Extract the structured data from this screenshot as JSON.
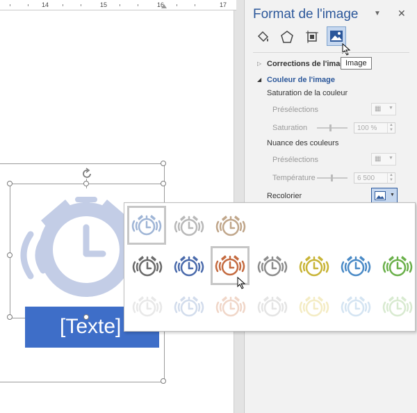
{
  "ruler": {
    "labels": [
      "14",
      "15",
      "16",
      "17"
    ]
  },
  "document": {
    "textbox_label": "[Texte]"
  },
  "panel": {
    "title": "Format de l'image",
    "close_glyph": "✕",
    "menu_glyph": "▼",
    "icons": [
      "fill-line-icon",
      "effects-icon",
      "layout-size-icon",
      "picture-icon"
    ],
    "tooltip": "Image",
    "sections": {
      "corrections": "Corrections de l'image",
      "couleur": "Couleur de l'image"
    },
    "saturation": {
      "header": "Saturation de la couleur",
      "presets_label": "Présélections",
      "value_label": "Saturation",
      "value": "100 %"
    },
    "nuance": {
      "header": "Nuance des couleurs",
      "presets_label": "Présélections",
      "value_label": "Température",
      "value": "6 500"
    },
    "recolor_label": "Recolorier"
  },
  "gallery": {
    "rows": [
      {
        "colors": [
          "#9fb5d6",
          "#b8b8b8",
          "#c0a68a"
        ]
      },
      {
        "colors": [
          "#6a6a6a",
          "#4a6aab",
          "#c46a3f",
          "#8c8c8c",
          "#c8b436",
          "#4a8ac6",
          "#6ab04a"
        ]
      },
      {
        "colors": [
          "#e8e8e8",
          "#d2dcec",
          "#f0d6c8",
          "#e4e4e4",
          "#f4ecc4",
          "#d4e4f2",
          "#d8ead0"
        ]
      }
    ]
  },
  "colors": {
    "accent": "#2b579a",
    "textbox_fill": "#3e6ec8",
    "clock_fill": "#c3cde6"
  }
}
